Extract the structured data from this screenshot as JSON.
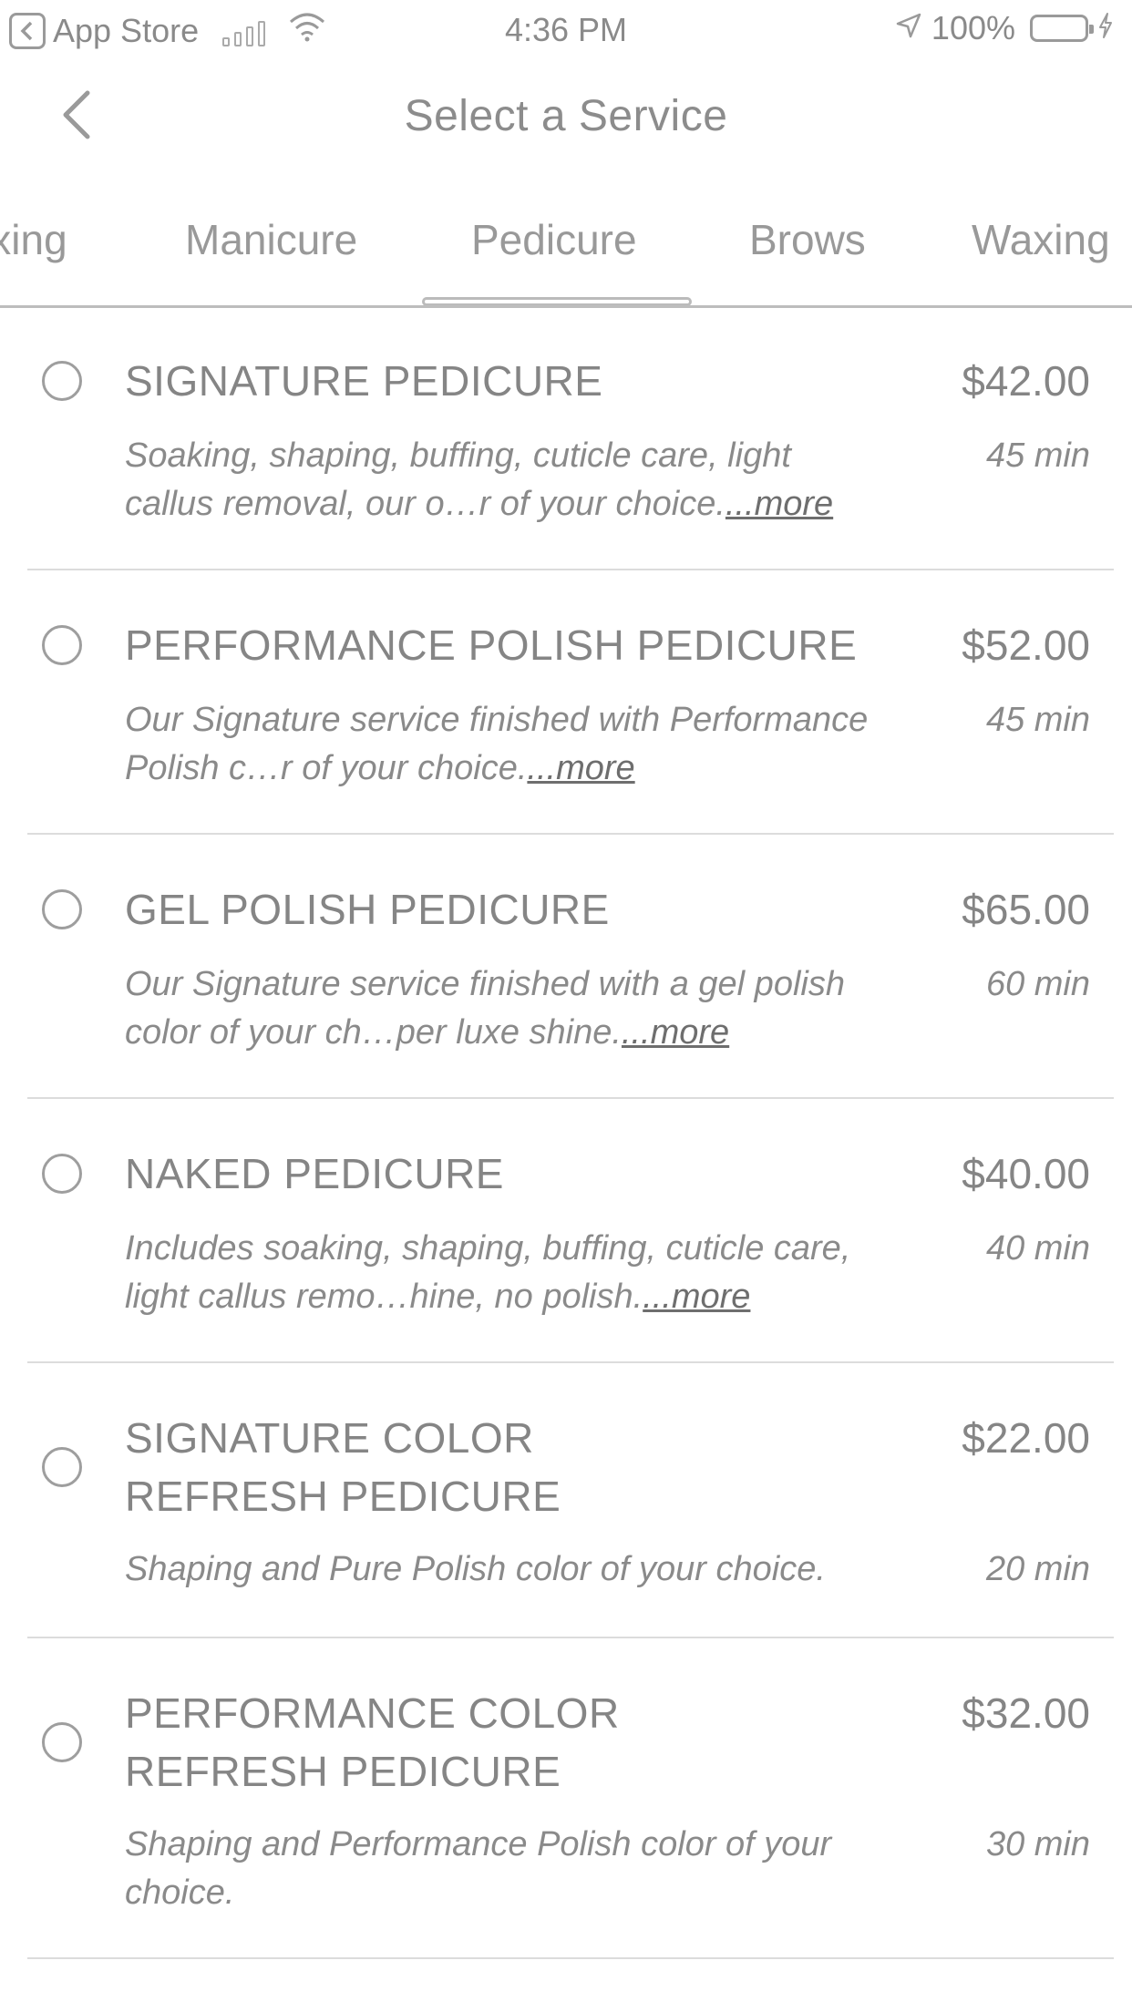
{
  "status_bar": {
    "back_app": "App Store",
    "time": "4:36 PM",
    "battery": "100%"
  },
  "nav": {
    "title": "Select a Service"
  },
  "tabs": [
    {
      "label": "Waxing"
    },
    {
      "label": "Manicure"
    },
    {
      "label": "Pedicure",
      "selected": true
    },
    {
      "label": "Brows"
    },
    {
      "label": "Waxing"
    }
  ],
  "services": [
    {
      "name": "SIGNATURE PEDICURE",
      "price": "$42.00",
      "description": "Soaking, shaping, buffing, cuticle care, light callus removal, our o…r of your choice.",
      "more": "...more",
      "duration": "45 min"
    },
    {
      "name": "PERFORMANCE POLISH PEDICURE",
      "price": "$52.00",
      "description": "Our Signature service finished with Performance Polish c…r of your choice.",
      "more": "...more",
      "duration": "45 min"
    },
    {
      "name": "GEL POLISH PEDICURE",
      "price": "$65.00",
      "description": "Our Signature service finished with a gel polish color of your ch…per luxe shine.",
      "more": "...more",
      "duration": "60 min"
    },
    {
      "name": "NAKED PEDICURE",
      "price": "$40.00",
      "description": "Includes soaking, shaping, buffing, cuticle care, light callus remo…hine, no polish.",
      "more": "...more",
      "duration": "40 min"
    },
    {
      "name": "SIGNATURE COLOR\nREFRESH PEDICURE",
      "price": "$22.00",
      "description": "Shaping and Pure Polish color of your choice.",
      "more": "",
      "duration": "20 min"
    },
    {
      "name": "PERFORMANCE COLOR\nREFRESH PEDICURE",
      "price": "$32.00",
      "description": "Shaping and Performance Polish color of your choice.",
      "more": "",
      "duration": "30 min"
    }
  ]
}
